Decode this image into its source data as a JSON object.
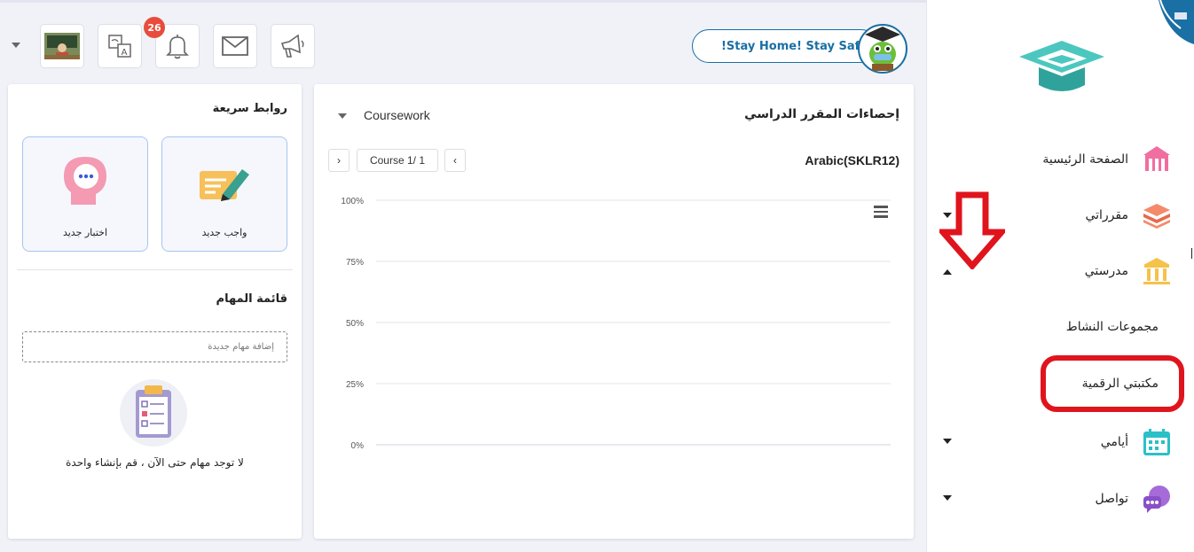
{
  "header": {
    "notification_count": "26",
    "stay_safe_text": "!Stay Home! Stay Safe"
  },
  "stats": {
    "title": "إحصاءات المقرر الدراسي",
    "filter_value": "Coursework",
    "course_name": "Arabic(SKLR12)",
    "pager_text": "Course 1/ 1",
    "prev_label": "‹",
    "next_label": "›"
  },
  "chart_data": {
    "type": "bar",
    "categories": [],
    "values": [],
    "yticks": [
      "100%",
      "75%",
      "50%",
      "25%",
      "0%"
    ],
    "ylim": [
      0,
      100
    ],
    "grid": true
  },
  "quick_links": {
    "title": "روابط سريعة",
    "new_assignment": "واجب جديد",
    "new_quiz": "اختبار جديد"
  },
  "tasks": {
    "title": "قائمة المهام",
    "placeholder": "إضافة مهام جديدة",
    "empty_text": "لا توجد مهام حتى الآن ، قم بإنشاء واحدة"
  },
  "sidebar": {
    "items": [
      {
        "label": "الصفحة الرئيسية",
        "icon": "home-icon"
      },
      {
        "label": "مقرراتي",
        "icon": "books-icon"
      },
      {
        "label": "مدرستي",
        "icon": "school-icon"
      },
      {
        "label": "أيامي",
        "icon": "calendar-icon"
      },
      {
        "label": "تواصل",
        "icon": "chat-icon"
      }
    ],
    "sub_items": [
      "مجموعات النشاط",
      "مكتبتي الرقمية"
    ]
  },
  "colors": {
    "accent_blue": "#1a6fa5",
    "highlight_red": "#e0141d",
    "badge_red": "#e74c3c"
  }
}
